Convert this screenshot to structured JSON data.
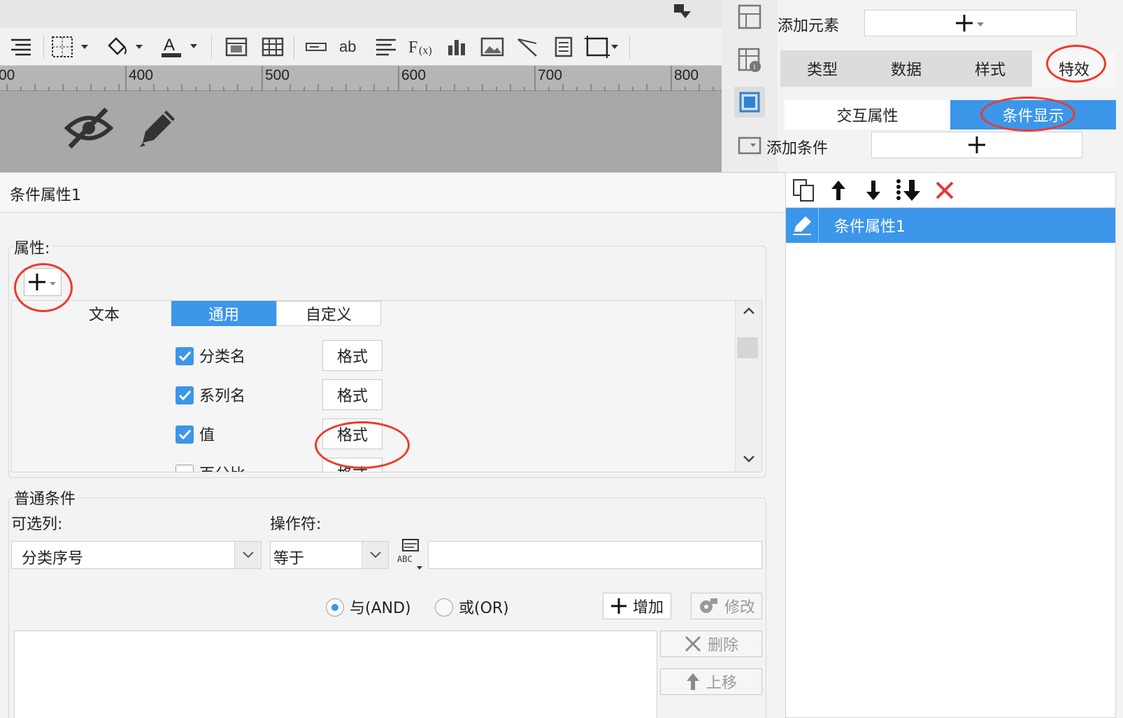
{
  "ruler": {
    "labels": [
      "00",
      "400",
      "500",
      "600",
      "700",
      "800"
    ]
  },
  "toolbar_icons": [
    "align-icon",
    "border-icon",
    "paint-bucket-icon",
    "font-color-icon",
    "merge-cell-icon",
    "table-icon",
    "textbox-icon",
    "ab-text-icon",
    "paragraph-icon",
    "formula-icon",
    "bar-chart-icon",
    "image-icon",
    "line-icon",
    "document-icon",
    "frame-icon"
  ],
  "right_panel": {
    "add_element_label": "添加元素",
    "tabs": [
      "类型",
      "数据",
      "样式",
      "特效"
    ],
    "subtabs": [
      "交互属性",
      "条件显示"
    ],
    "add_condition_label": "添加条件",
    "list_items": [
      "条件属性1"
    ]
  },
  "dialog": {
    "title": "条件属性1",
    "attributes_label": "属性:",
    "text_label": "文本",
    "segments": [
      "通用",
      "自定义"
    ],
    "rows": [
      {
        "label": "分类名",
        "checked": true,
        "button": "格式"
      },
      {
        "label": "系列名",
        "checked": true,
        "button": "格式"
      },
      {
        "label": "值",
        "checked": true,
        "button": "格式"
      },
      {
        "label": "百分比",
        "checked": false,
        "button": "格式"
      }
    ],
    "normal_condition_label": "普通条件",
    "optional_column_label": "可选列:",
    "operator_label": "操作符:",
    "column_value": "分类序号",
    "operator_value": "等于",
    "formula_icon_text": "ABC",
    "radio_and": "与(AND)",
    "radio_or": "或(OR)",
    "add_button": "增加",
    "modify_button": "修改",
    "delete_button": "删除",
    "move_up_button": "上移"
  },
  "colors": {
    "accent": "#3c96ea",
    "highlight_ring": "#ee3a2c",
    "delete": "#e53935"
  }
}
